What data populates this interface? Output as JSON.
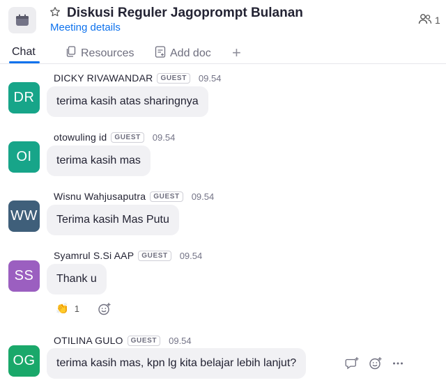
{
  "header": {
    "title": "Diskusi Reguler Jagoprompt Bulanan",
    "subtitle_link": "Meeting details",
    "participant_count": "1"
  },
  "tabs": [
    {
      "label": "Chat",
      "active": true,
      "icon": null
    },
    {
      "label": "Resources",
      "active": false,
      "icon": "copy-icon"
    },
    {
      "label": "Add doc",
      "active": false,
      "icon": "doc-icon"
    },
    {
      "label": "+",
      "active": false,
      "icon": "plus-icon"
    }
  ],
  "guest_badge": "GUEST",
  "colors": {
    "accent": "#0e72ed",
    "avatar_teal": "#17a589",
    "avatar_slate": "#3f5f7a",
    "avatar_purple": "#9b5fc0",
    "avatar_green": "#1aa86a"
  },
  "messages": [
    {
      "initials": "DR",
      "sender": "DICKY RIVAWANDAR",
      "guest": true,
      "time": "09.54",
      "text": "terima kasih atas sharingnya"
    },
    {
      "initials": "OI",
      "sender": "otowuling id",
      "guest": true,
      "time": "09.54",
      "text": "terima kasih mas"
    },
    {
      "initials": "WW",
      "sender": "Wisnu Wahjusaputra",
      "guest": true,
      "time": "09.54",
      "text": "Terima kasih Mas Putu"
    },
    {
      "initials": "SS",
      "sender": "Syamrul S.Si AAP",
      "guest": true,
      "time": "09.54",
      "text": "Thank u",
      "reaction": {
        "emoji": "👏",
        "count": "1"
      }
    },
    {
      "initials": "OG",
      "sender": "OTILINA GULO",
      "guest": true,
      "time": "09.54",
      "text": "terima kasih mas, kpn lg kita belajar lebih lanjut?"
    }
  ]
}
